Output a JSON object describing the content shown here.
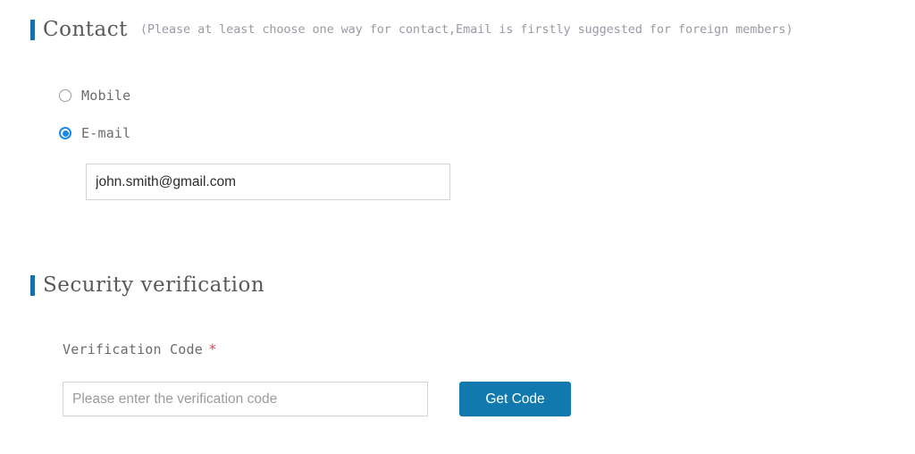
{
  "contact_section": {
    "title": "Contact",
    "hint": "(Please at least choose one way for contact,Email is firstly suggested for foreign members)",
    "options": [
      {
        "label": "Mobile",
        "selected": false
      },
      {
        "label": "E-mail",
        "selected": true
      }
    ],
    "email_value": "john.smith@gmail.com",
    "email_placeholder": ""
  },
  "security_section": {
    "title": "Security verification",
    "code_label": "Verification Code",
    "required_mark": "*",
    "code_value": "",
    "code_placeholder": "Please enter the verification code",
    "get_code_label": "Get Code"
  },
  "colors": {
    "accent_bar": "#1a6ea8",
    "button_blue": "#1179ad",
    "radio_selected": "#1e88e5",
    "required_red": "#c94b5c",
    "heading_text": "#595959",
    "body_text": "#6b6b6b",
    "placeholder": "#9b9b9b",
    "input_border": "#d2d2d2",
    "background": "#ffffff"
  }
}
